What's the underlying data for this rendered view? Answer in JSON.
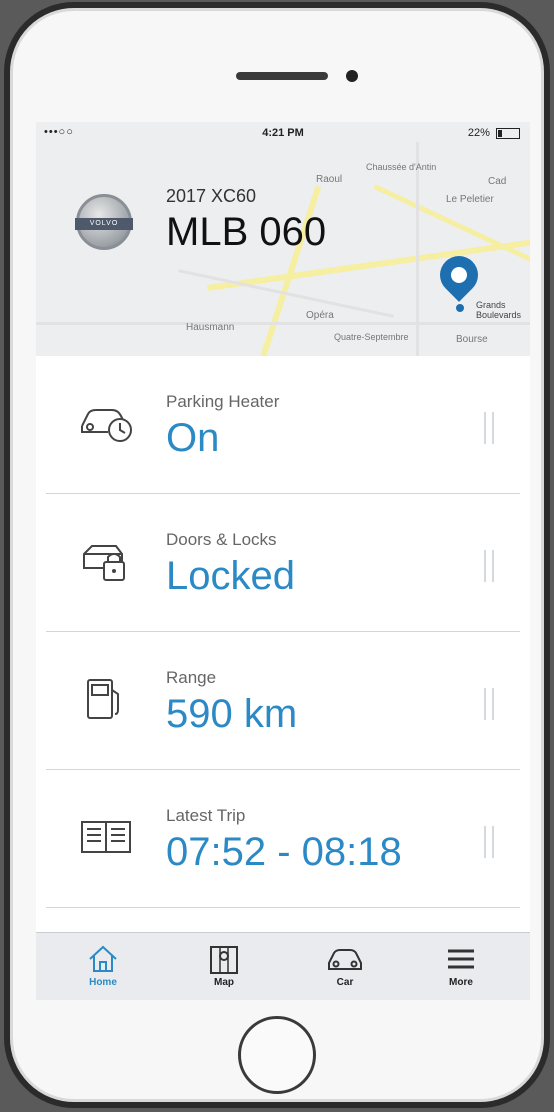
{
  "status_bar": {
    "signal": "•••○○",
    "time": "4:21 PM",
    "battery": "22%"
  },
  "vehicle": {
    "model": "2017 XC60",
    "plate": "MLB 060",
    "logo_text": "VOLVO"
  },
  "map": {
    "labels": [
      "Raoul",
      "Le Peletier",
      "Cad",
      "Hausmann",
      "Opéra",
      "Quatre-Septembre",
      "Grands Boulevards",
      "Bourse",
      "Chaussée d'Antin"
    ]
  },
  "items": [
    {
      "label": "Parking Heater",
      "value": "On",
      "icon": "car-clock-icon"
    },
    {
      "label": "Doors & Locks",
      "value": "Locked",
      "icon": "car-lock-icon"
    },
    {
      "label": "Range",
      "value": "590 km",
      "icon": "fuel-pump-icon"
    },
    {
      "label": "Latest Trip",
      "value": "07:52 - 08:18",
      "icon": "logbook-icon"
    }
  ],
  "tabs": [
    {
      "label": "Home",
      "icon": "home-icon",
      "active": true
    },
    {
      "label": "Map",
      "icon": "map-icon",
      "active": false
    },
    {
      "label": "Car",
      "icon": "car-icon",
      "active": false
    },
    {
      "label": "More",
      "icon": "menu-icon",
      "active": false
    }
  ],
  "colors": {
    "accent": "#2b8ac6",
    "pin": "#1d6fb0",
    "divider": "#d0d6dc",
    "tabbar": "#e9ebee"
  }
}
